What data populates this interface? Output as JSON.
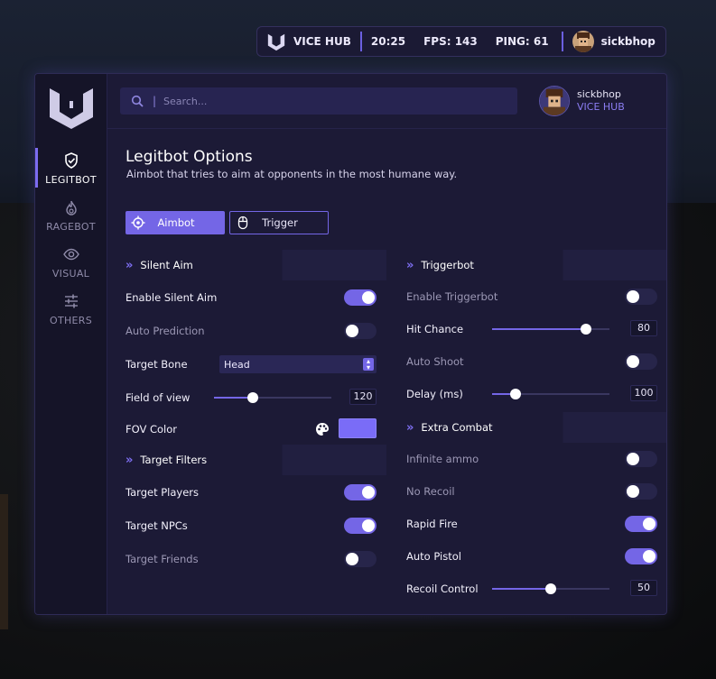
{
  "topbar": {
    "brand": "VICE HUB",
    "time": "20:25",
    "fps": "FPS: 143",
    "ping": "PING: 61",
    "username": "sickbhop"
  },
  "sidebar": {
    "items": [
      {
        "label": "LEGITBOT",
        "icon": "shield-check-icon",
        "active": true
      },
      {
        "label": "RAGEBOT",
        "icon": "flame-icon",
        "active": false
      },
      {
        "label": "VISUAL",
        "icon": "eye-icon",
        "active": false
      },
      {
        "label": "OTHERS",
        "icon": "sliders-icon",
        "active": false
      }
    ]
  },
  "header": {
    "search_placeholder": "Search...",
    "username": "sickbhop",
    "brand": "VICE HUB"
  },
  "page": {
    "title": "Legitbot Options",
    "subtitle": "Aimbot that tries to aim at opponents in the most humane way."
  },
  "tabs": [
    {
      "label": "Aimbot",
      "active": true
    },
    {
      "label": "Trigger",
      "active": false
    }
  ],
  "left": {
    "silent_aim": {
      "title": "Silent Aim",
      "enable_label": "Enable Silent Aim",
      "enable_value": true,
      "auto_prediction_label": "Auto Prediction",
      "auto_prediction_value": false,
      "target_bone_label": "Target Bone",
      "target_bone_value": "Head",
      "fov_label": "Field of view",
      "fov_value": "120",
      "fov_fraction": 0.33,
      "fov_color_label": "FOV Color",
      "fov_color": "#7a6cf7"
    },
    "target_filters": {
      "title": "Target Filters",
      "players_label": "Target Players",
      "players_value": true,
      "npcs_label": "Target NPCs",
      "npcs_value": true,
      "friends_label": "Target Friends",
      "friends_value": false
    }
  },
  "right": {
    "triggerbot": {
      "title": "Triggerbot",
      "enable_label": "Enable Triggerbot",
      "enable_value": false,
      "hit_chance_label": "Hit Chance",
      "hit_chance_value": "80",
      "hit_chance_fraction": 0.8,
      "auto_shoot_label": "Auto Shoot",
      "auto_shoot_value": false,
      "delay_label": "Delay (ms)",
      "delay_value": "100",
      "delay_fraction": 0.2
    },
    "extra_combat": {
      "title": "Extra Combat",
      "infinite_ammo_label": "Infinite ammo",
      "infinite_ammo_value": false,
      "no_recoil_label": "No Recoil",
      "no_recoil_value": false,
      "rapid_fire_label": "Rapid Fire",
      "rapid_fire_value": true,
      "auto_pistol_label": "Auto Pistol",
      "auto_pistol_value": true,
      "recoil_control_label": "Recoil Control",
      "recoil_control_value": "50",
      "recoil_control_fraction": 0.5
    }
  },
  "colors": {
    "accent": "#7466e6",
    "panel": "#1c1a36",
    "sidebar": "#151428"
  }
}
